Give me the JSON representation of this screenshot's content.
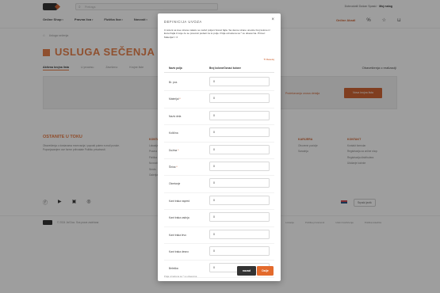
{
  "header": {
    "search_placeholder": "Pretraga",
    "welcome_prefix": "Dobrodošli Dušan Spasić",
    "account_label": "Moj nalog",
    "nav": [
      "Online Shop",
      "Pravna lica",
      "Fizička lica",
      "Novosti"
    ],
    "online_button": "Online Akadi"
  },
  "breadcrumb": {
    "current": "Usluga sečenja"
  },
  "page": {
    "title": "USLUGA SEČENJA",
    "tabs": [
      "Aktivna krojna lista",
      "U procesu",
      "Završeno",
      "Krojne liste"
    ],
    "tab_right": "Obaveštenja o realizaciji",
    "link_right": "Podešavanja unosa detalja",
    "new_button": "Nova krojna lista"
  },
  "footer": {
    "title": "OSTANITE U TOKU",
    "desc": "Obaveštenja o dostavama rezervacija i popusti putem e-mail poruke. Popunjavanjem ove forme prihvatate Politiku privatnosti.",
    "col1": {
      "head": "KONTAKT",
      "items": [
        "Lokacije",
        "Pravna lica",
        "Fizička lica",
        "Novosti",
        "Servis",
        "Galerija"
      ]
    },
    "col2": {
      "head": "KARIJERA",
      "items": [
        "Otvorene pozicije",
        "Saradnja"
      ]
    },
    "col3": {
      "head": "KONTAKT",
      "items": [
        "Kontakt formular",
        "Registracija za online shop",
        "Registracija distributera",
        "Ukidanje lozinke"
      ]
    },
    "language_value": "Srpski jezik",
    "copyright": "© 2024 Jaf Doo. Sva prava zadržana",
    "legal": [
      "Lokacije",
      "Politika privatnosti",
      "Uslovi korišćenja",
      "Politika kolačića"
    ]
  },
  "modal": {
    "title": "DEFINICIJA UVOZA",
    "description": "U koloni sa leve strane nalaze se nazivi polja iz Excel fajla. Sa desne strane unesite broj kolone iz Excel fajla iz koje će se preuzeti podaci za to polje. Polja označena sa * su obavezna. Primer: Materijal = 3",
    "reset_label": "Resetuj",
    "col_field": "Naziv polja",
    "col_column": "Broj kolone/Oznaci kolone",
    "fields": [
      {
        "label": "Br. poz.",
        "required": false,
        "value": "0"
      },
      {
        "label": "Materijal",
        "required": true,
        "value": "0"
      },
      {
        "label": "Naziv dela",
        "required": false,
        "value": "0"
      },
      {
        "label": "Količina",
        "required": false,
        "value": "0"
      },
      {
        "label": "Dužina",
        "required": true,
        "value": "0"
      },
      {
        "label": "Širina",
        "required": true,
        "value": "0"
      },
      {
        "label": "Okretanje",
        "required": false,
        "value": "0"
      },
      {
        "label": "Kant traka napred",
        "required": false,
        "value": "0"
      },
      {
        "label": "Kant traka zadnja",
        "required": false,
        "value": "0"
      },
      {
        "label": "Kant traka levo",
        "required": false,
        "value": "0"
      },
      {
        "label": "Kant traka desno",
        "required": false,
        "value": "0"
      },
      {
        "label": "Beleška",
        "required": false,
        "value": "0"
      }
    ],
    "foot_note": "Polja označena sa * su obavezna",
    "back_label": "nazad",
    "next_label": "Dalje"
  },
  "colors": {
    "accent": "#e36a2c",
    "accent_dark": "#c8511b",
    "dark": "#333333"
  }
}
